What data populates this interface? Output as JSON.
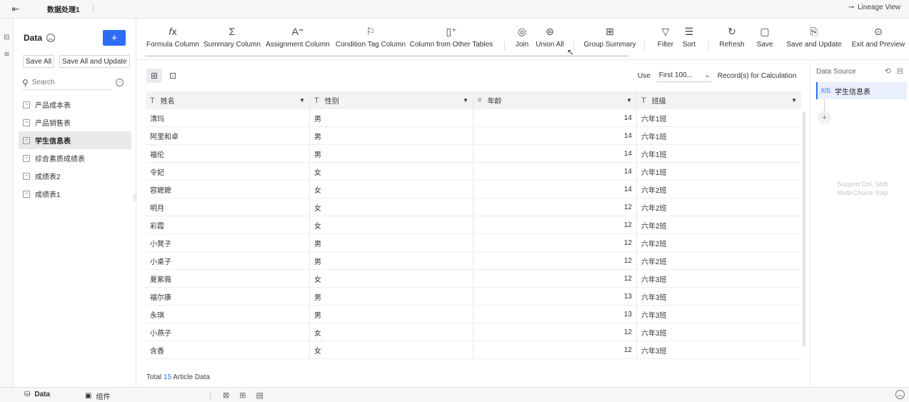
{
  "titlebar": {
    "tab_title": "数据处理1",
    "more_glyph": "⋮",
    "lineage_label": "Lineage View"
  },
  "datapanel": {
    "title": "Data",
    "add_label": "+",
    "save_all": "Save All",
    "save_all_update": "Save All and Update",
    "search_placeholder": "Search",
    "tables": [
      {
        "label": "产品成本表",
        "active": false
      },
      {
        "label": "产品销售表",
        "active": false
      },
      {
        "label": "学生信息表",
        "active": true
      },
      {
        "label": "综合素质成绩表",
        "active": false
      },
      {
        "label": "成绩表2",
        "active": false
      },
      {
        "label": "成绩表1",
        "active": false
      }
    ]
  },
  "toolbar": {
    "items": [
      {
        "label": "Formula Column",
        "icon": "fx-icon",
        "glyph": "𝑓x"
      },
      {
        "label": "Summary Column",
        "icon": "sigma-icon",
        "glyph": "Σ"
      },
      {
        "label": "Assignment Column",
        "icon": "assign-icon",
        "glyph": "A⁼"
      },
      {
        "label": "Condition Tag Column",
        "icon": "tag-icon",
        "glyph": "⚐"
      },
      {
        "label": "Column from Other Tables",
        "icon": "other-table-icon",
        "glyph": "▯⁺"
      },
      {
        "label": "Join",
        "icon": "join-icon",
        "glyph": "◎"
      },
      {
        "label": "Union All",
        "icon": "union-icon",
        "glyph": "⊜"
      },
      {
        "label": "Group Summary",
        "icon": "group-icon",
        "glyph": "⊞"
      },
      {
        "label": "Filter",
        "icon": "filter-icon",
        "glyph": "▽"
      },
      {
        "label": "Sort",
        "icon": "sort-icon",
        "glyph": "☰"
      },
      {
        "label": "Refresh",
        "icon": "refresh-icon",
        "glyph": "↻"
      },
      {
        "label": "Save",
        "icon": "save-icon",
        "glyph": "▢"
      },
      {
        "label": "Save and Update",
        "icon": "save-update-icon",
        "glyph": "⎘"
      },
      {
        "label": "Exit and Preview",
        "icon": "exit-preview-icon",
        "glyph": "⊙"
      }
    ]
  },
  "controls": {
    "use_label": "Use",
    "use_value": "First 100...",
    "records_label": "Record(s) for Calculation"
  },
  "grid": {
    "columns": [
      {
        "label": "姓名",
        "type_glyph": "T"
      },
      {
        "label": "性别",
        "type_glyph": "T"
      },
      {
        "label": "年龄",
        "type_glyph": "#"
      },
      {
        "label": "班级",
        "type_glyph": "T"
      }
    ],
    "rows": [
      [
        "淸玛",
        "男",
        "14",
        "六年1班"
      ],
      [
        "阿里和卓",
        "男",
        "14",
        "六年1班"
      ],
      [
        "福伦",
        "男",
        "14",
        "六年1班"
      ],
      [
        "令妃",
        "女",
        "14",
        "六年1班"
      ],
      [
        "容嬷嬷",
        "女",
        "14",
        "六年2班"
      ],
      [
        "明月",
        "女",
        "12",
        "六年2班"
      ],
      [
        "彩霞",
        "女",
        "12",
        "六年2班"
      ],
      [
        "小凳子",
        "男",
        "12",
        "六年2班"
      ],
      [
        "小桌子",
        "男",
        "12",
        "六年2班"
      ],
      [
        "夏紫薇",
        "女",
        "12",
        "六年3班"
      ],
      [
        "福尔康",
        "男",
        "13",
        "六年3班"
      ],
      [
        "永琪",
        "男",
        "13",
        "六年3班"
      ],
      [
        "小燕子",
        "女",
        "12",
        "六年3班"
      ],
      [
        "含香",
        "女",
        "12",
        "六年3班"
      ]
    ],
    "total_prefix": "Total",
    "total_count": "15",
    "total_suffix": "Article Data"
  },
  "rpanel": {
    "title": "Data Source",
    "node_type": "XlS",
    "node_label": "学生信息表",
    "hint_line1": "Support Ctrl, Shift",
    "hint_line2": "Multi-Choice Step"
  },
  "bottombar": {
    "tab_data": "Data",
    "tab_component": "组件"
  },
  "colors": {
    "accent": "#2d6df5",
    "active_row": "#e8e9eb",
    "header_bg": "#f1f3f5"
  }
}
